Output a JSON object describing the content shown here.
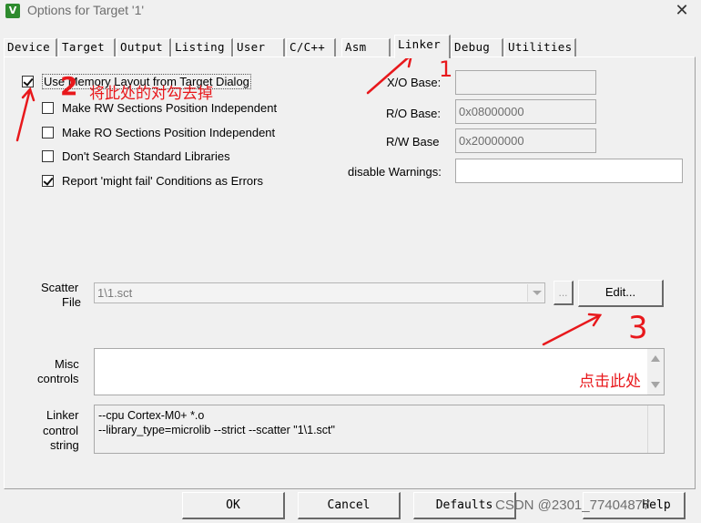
{
  "window": {
    "title": "Options for Target '1'",
    "close_glyph": "✕",
    "icon": "keil-uvision-icon",
    "icon_letter": "V"
  },
  "tabs": [
    {
      "label": "Device",
      "active": false
    },
    {
      "label": "Target",
      "active": false
    },
    {
      "label": "Output",
      "active": false
    },
    {
      "label": "Listing",
      "active": false
    },
    {
      "label": "User",
      "active": false
    },
    {
      "label": "C/C++",
      "active": false
    },
    {
      "label": "Asm",
      "active": false
    },
    {
      "label": "Linker",
      "active": true
    },
    {
      "label": "Debug",
      "active": false
    },
    {
      "label": "Utilities",
      "active": false
    }
  ],
  "checkboxes": [
    {
      "label": "Use Memory Layout from Target Dialog",
      "checked": true
    },
    {
      "label": "Make RW Sections Position Independent",
      "checked": false
    },
    {
      "label": "Make RO Sections Position Independent",
      "checked": false
    },
    {
      "label": "Don't Search Standard Libraries",
      "checked": false
    },
    {
      "label": "Report 'might fail' Conditions as Errors",
      "checked": true
    }
  ],
  "address_fields": {
    "xo_label": "X/O Base:",
    "xo_value": "",
    "ro_label": "R/O Base:",
    "ro_value": "0x08000000",
    "rw_label": "R/W Base",
    "rw_value": "0x20000000",
    "warnings_label": "disable Warnings:",
    "warnings_value": ""
  },
  "scatter": {
    "label_line1": "Scatter",
    "label_line2": "File",
    "value": "1\\1.sct",
    "browse_label": "...",
    "edit_label": "Edit..."
  },
  "misc": {
    "label_line1": "Misc",
    "label_line2": "controls",
    "value": ""
  },
  "linker_control": {
    "label_line1": "Linker",
    "label_line2": "control",
    "label_line3": "string",
    "lines": [
      "--cpu Cortex-M0+ *.o",
      "--library_type=microlib --strict --scatter \"1\\1.sct\""
    ]
  },
  "buttons": {
    "ok": "OK",
    "cancel": "Cancel",
    "defaults": "Defaults",
    "help": "Help"
  },
  "annotations": {
    "step1": "1",
    "step2": "2",
    "step2_text": "将此处的对勾去掉",
    "step3": "3",
    "step3_text": "点击此处",
    "color": "#e8181c"
  },
  "watermark": "CSDN @2301_77404877"
}
